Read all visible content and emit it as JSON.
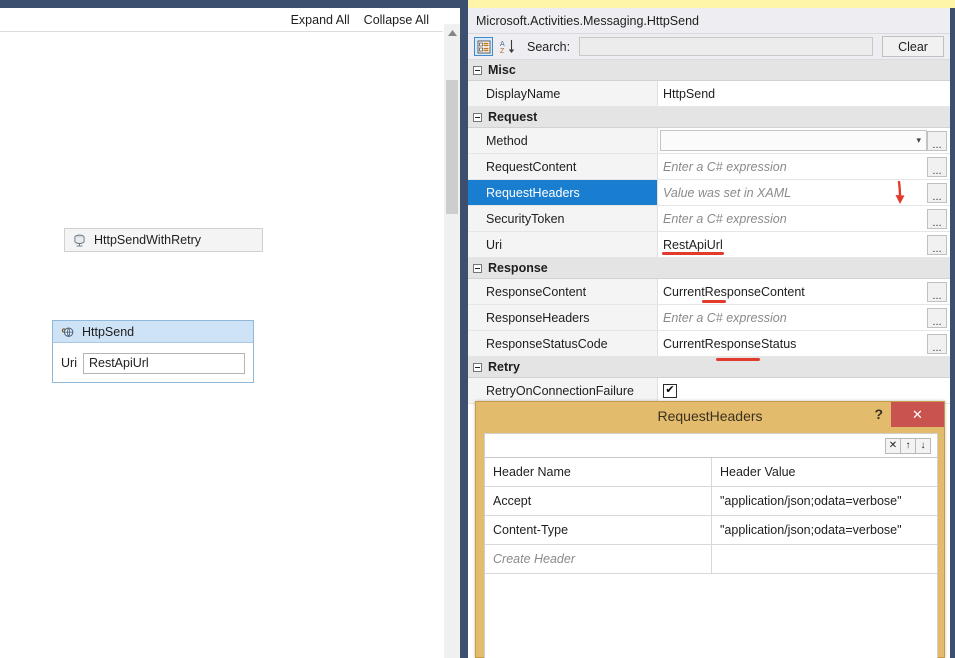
{
  "designer": {
    "toolbar": {
      "expand_all": "Expand All",
      "collapse_all": "Collapse All"
    },
    "activities": [
      {
        "name": "HttpSendWithRetry",
        "icon": "spool-icon"
      },
      {
        "name": "HttpSend",
        "icon": "http-send-icon",
        "fields": [
          {
            "label": "Uri",
            "value": "RestApiUrl"
          }
        ]
      }
    ]
  },
  "properties": {
    "target_type": "Microsoft.Activities.Messaging.HttpSend",
    "toolbar": {
      "categorized_icon": "categorized-view-icon",
      "alphabetical_icon": "alphabetical-sort-icon",
      "search_label": "Search:",
      "search_value": "",
      "search_placeholder": "",
      "clear_label": "Clear"
    },
    "groups": [
      {
        "name": "Misc",
        "rows": [
          {
            "name": "DisplayName",
            "value": "HttpSend",
            "kind": "text",
            "selected": false,
            "ellipsis": false
          }
        ]
      },
      {
        "name": "Request",
        "rows": [
          {
            "name": "Method",
            "value": "",
            "kind": "combo",
            "selected": false,
            "ellipsis": true
          },
          {
            "name": "RequestContent",
            "value": "Enter a C# expression",
            "kind": "placeholder",
            "selected": false,
            "ellipsis": true
          },
          {
            "name": "RequestHeaders",
            "value": "Value was set in XAML",
            "kind": "placeholder",
            "selected": true,
            "ellipsis": true
          },
          {
            "name": "SecurityToken",
            "value": "Enter a C# expression",
            "kind": "placeholder",
            "selected": false,
            "ellipsis": true
          },
          {
            "name": "Uri",
            "value": "RestApiUrl",
            "kind": "text",
            "selected": false,
            "ellipsis": true
          }
        ]
      },
      {
        "name": "Response",
        "rows": [
          {
            "name": "ResponseContent",
            "value": "CurrentResponseContent",
            "kind": "text",
            "selected": false,
            "ellipsis": true
          },
          {
            "name": "ResponseHeaders",
            "value": "Enter a C# expression",
            "kind": "placeholder",
            "selected": false,
            "ellipsis": true
          },
          {
            "name": "ResponseStatusCode",
            "value": "CurrentResponseStatus",
            "kind": "text",
            "selected": false,
            "ellipsis": true
          }
        ]
      },
      {
        "name": "Retry",
        "rows": [
          {
            "name": "RetryOnConnectionFailure",
            "value": "✔",
            "kind": "checkbox",
            "selected": false,
            "ellipsis": false
          }
        ]
      }
    ],
    "ellipsis_label": "..."
  },
  "annotations": {
    "color": "#e23b2e",
    "arrow_icon": "red-down-arrow-annotation",
    "underlines": [
      "RestApiUrl",
      "CurrentResponseContent",
      "CurrentResponseStatus",
      "RetryOnConnectionFailure"
    ]
  },
  "dialog": {
    "title": "RequestHeaders",
    "help_label": "?",
    "close_label": "✕",
    "toolbar_buttons": [
      {
        "icon": "delete-row-icon",
        "glyph": "✕"
      },
      {
        "icon": "move-up-icon",
        "glyph": "↑"
      },
      {
        "icon": "move-down-icon",
        "glyph": "↓"
      }
    ],
    "columns": [
      "Header Name",
      "Header Value"
    ],
    "rows": [
      {
        "name": "Accept",
        "value": "\"application/json;odata=verbose\"",
        "placeholder": false
      },
      {
        "name": "Content-Type",
        "value": "\"application/json;odata=verbose\"",
        "placeholder": false
      },
      {
        "name": "Create Header",
        "value": "",
        "placeholder": true
      }
    ]
  }
}
